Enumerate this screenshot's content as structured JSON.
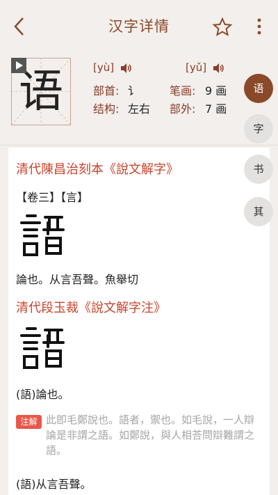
{
  "topbar": {
    "title": "汉字详情"
  },
  "char": {
    "glyph": "语",
    "pinyin1": "[yù]",
    "pinyin2": "[yǔ]",
    "bushou_label": "部首:",
    "bushou": "讠",
    "bihua_label": "笔画:",
    "bihua": "9 画",
    "jiegou_label": "结构:",
    "jiegou": "左右",
    "buwai_label": "部外:",
    "buwai": "7 画"
  },
  "side_tabs": [
    "语",
    "字",
    "书",
    "其"
  ],
  "content": {
    "section1_title": "清代陳昌治刻本《說文解字》",
    "volume": "【卷三】【言】",
    "def1": "論也。从言吾聲。魚舉切",
    "section2_title": "清代段玉裁《說文解字注》",
    "def2": "(語)論也。",
    "note_badge": "注解",
    "note": "此卽毛鄭說也。語者，禦也。如毛說，一人辯論是非謂之語。如鄭說，與人相荅問辯難謂之語。",
    "def3": "(語)从言吾聲。"
  },
  "colors": {
    "accent": "#8a4a2a",
    "section_red": "#c8442c",
    "background": "#f2efec"
  }
}
